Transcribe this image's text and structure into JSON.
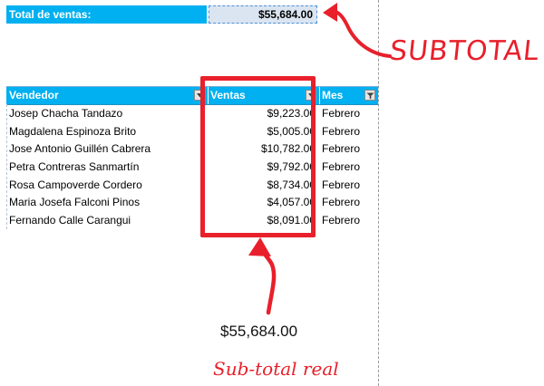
{
  "summary": {
    "label": "Total de ventas:",
    "value": "$55,684.00"
  },
  "table": {
    "headers": {
      "vendedor": "Vendedor",
      "ventas": "Ventas",
      "mes": "Mes"
    },
    "rows": [
      {
        "vendedor": "Josep Chacha Tandazo",
        "ventas": "$9,223.00",
        "mes": "Febrero"
      },
      {
        "vendedor": "Magdalena Espinoza Brito",
        "ventas": "$5,005.00",
        "mes": "Febrero"
      },
      {
        "vendedor": "Jose Antonio Guillén Cabrera",
        "ventas": "$10,782.00",
        "mes": "Febrero"
      },
      {
        "vendedor": "Petra Contreras Sanmartín",
        "ventas": "$9,792.00",
        "mes": "Febrero"
      },
      {
        "vendedor": "Rosa Campoverde Cordero",
        "ventas": "$8,734.00",
        "mes": "Febrero"
      },
      {
        "vendedor": "Maria Josefa Falconi Pinos",
        "ventas": "$4,057.00",
        "mes": "Febrero"
      },
      {
        "vendedor": "Fernando Calle Carangui",
        "ventas": "$8,091.00",
        "mes": "Febrero"
      }
    ]
  },
  "annotations": {
    "subtotal": "SUBTOTAL",
    "real_total": "$55,684.00",
    "subtotal_real": "Sub-total real"
  },
  "colors": {
    "header_fill": "#00b0f0",
    "total_cell_fill": "#dbe5f1",
    "annotation_red": "#e8202b"
  },
  "icons": {
    "filter_dropdown": "dropdown-arrow-icon",
    "filter_active": "filter-funnel-icon",
    "sort_desc": "sort-descending-icon"
  }
}
